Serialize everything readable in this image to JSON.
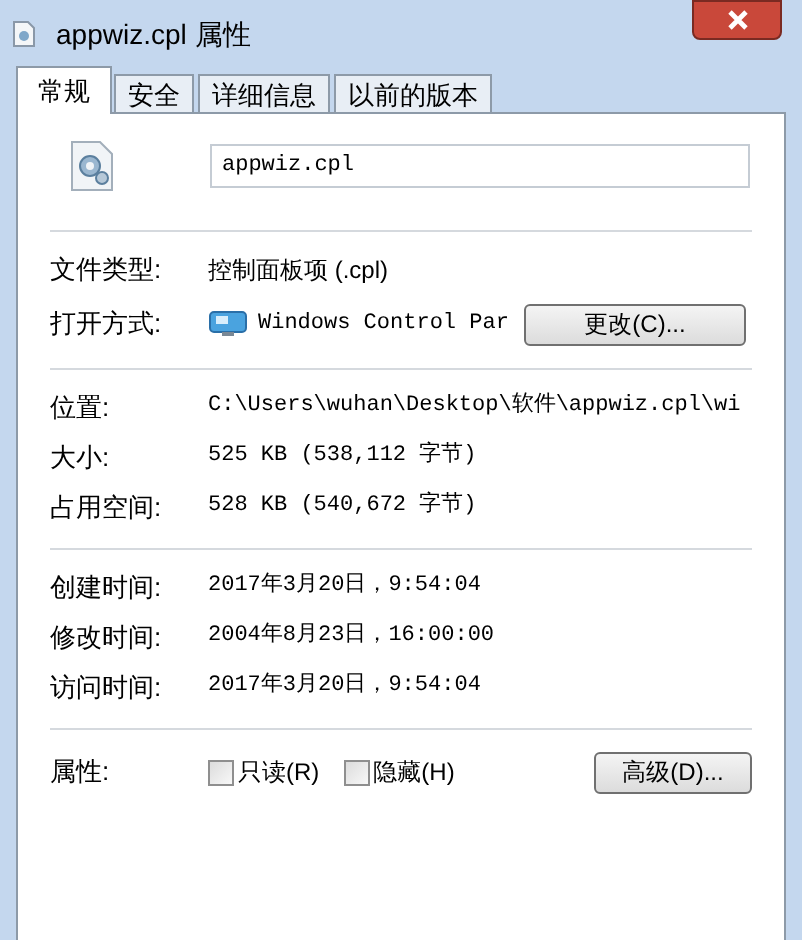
{
  "window": {
    "title": "appwiz.cpl 属性"
  },
  "tabs": [
    {
      "label": "常规",
      "selected": true
    },
    {
      "label": "安全",
      "selected": false
    },
    {
      "label": "详细信息",
      "selected": false
    },
    {
      "label": "以前的版本",
      "selected": false
    }
  ],
  "file_name": "appwiz.cpl",
  "type_section": {
    "file_type_label": "文件类型:",
    "file_type": "控制面板项 (.cpl)",
    "open_with_label": "打开方式:",
    "open_with": "Windows Control Par",
    "change_button": "更改(C)..."
  },
  "location_section": [
    {
      "label": "位置:",
      "value": "C:\\Users\\wuhan\\Desktop\\软件\\appwiz.cpl\\wi"
    },
    {
      "label": "大小:",
      "value": "525 KB (538,112 字节)"
    },
    {
      "label": "占用空间:",
      "value": "528 KB (540,672 字节)"
    }
  ],
  "time_section": [
    {
      "label": "创建时间:",
      "value": "2017年3月20日，9:54:04"
    },
    {
      "label": "修改时间:",
      "value": "2004年8月23日，16:00:00"
    },
    {
      "label": "访问时间:",
      "value": "2017年3月20日，9:54:04"
    }
  ],
  "attributes": {
    "label": "属性:",
    "checkboxes": [
      {
        "label": "只读(R)",
        "checked": false
      },
      {
        "label": "隐藏(H)",
        "checked": false
      }
    ],
    "advanced_button": "高级(D)..."
  }
}
